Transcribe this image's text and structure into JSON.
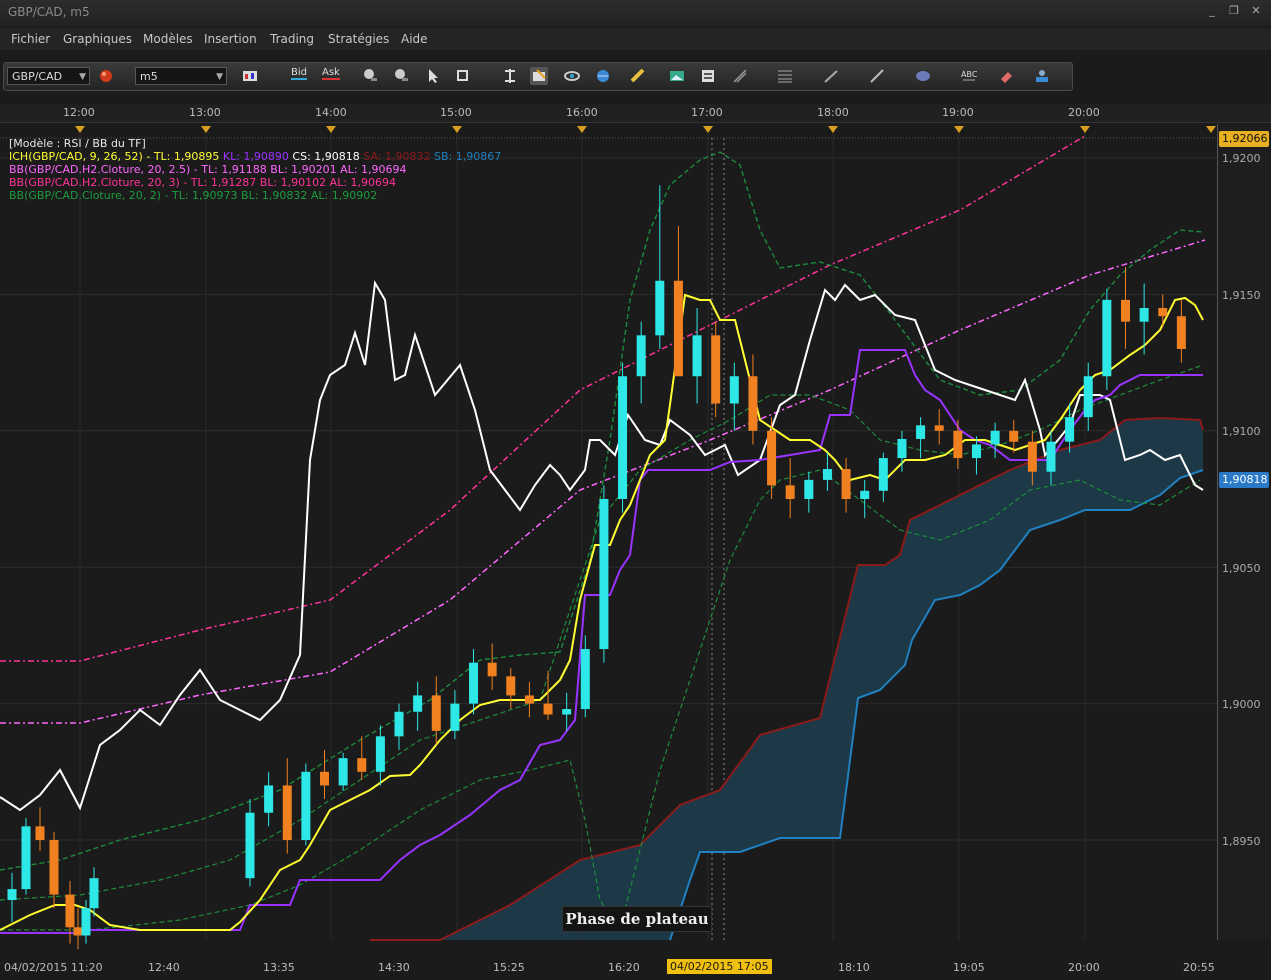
{
  "window": {
    "title": "GBP/CAD, m5",
    "minimize": "_",
    "restore": "❐",
    "close": "✕"
  },
  "menu": [
    "Fichier",
    "Graphiques",
    "Modèles",
    "Insertion",
    "Trading",
    "Stratégies",
    "Aide"
  ],
  "toolbar": {
    "symbol": "GBP/CAD",
    "timeframe": "m5",
    "bid_label": "Bid",
    "ask_label": "Ask",
    "icons": [
      "chart-type-icon",
      "red-ball-icon",
      "bar-style-icon",
      "zoom-in-icon",
      "zoom-out-icon",
      "cursor-icon",
      "crosshair-icon",
      "fit-icon",
      "cursor-sync-icon",
      "eye-icon",
      "globe-icon",
      "ruler-icon",
      "image-icon",
      "template-icon",
      "trendline-icon",
      "fib-icon",
      "pen-icon",
      "line-icon",
      "ellipse-icon",
      "text-icon",
      "eraser-icon",
      "objects-icon"
    ]
  },
  "time_axis_top": [
    "12:00",
    "13:00",
    "14:00",
    "15:00",
    "16:00",
    "17:00",
    "18:00",
    "19:00",
    "20:00"
  ],
  "time_axis_bottom": [
    "04/02/2015 11:20",
    "12:40",
    "13:35",
    "14:30",
    "15:25",
    "16:20",
    "18:10",
    "19:05",
    "20:00",
    "20:55"
  ],
  "cursor_time": "04/02/2015 17:05",
  "price_axis": [
    "1,9200",
    "1,9150",
    "1,9100",
    "1,9050",
    "1,9000",
    "1,8950"
  ],
  "price_tags": {
    "top": "1,92066",
    "current": "1,90818"
  },
  "legend": {
    "model": "[Modèle : RSI / BB du TF]",
    "ich_label": "ICH(GBP/CAD, 9, 26, 52) -",
    "ich_tl": "TL: 1,90895",
    "ich_kl": "KL: 1,90890",
    "ich_cs": "CS: 1,90818",
    "ich_sa": "SA: 1,90832",
    "ich_sb": "SB: 1,90867",
    "bb1": "BB(GBP/CAD.H2.Cloture, 20, 2.5) -  TL: 1,91188  BL: 1,90201  AL: 1,90694",
    "bb2": "BB(GBP/CAD.H2.Cloture, 20, 3) -  TL: 1,91287  BL: 1,90102  AL: 1,90694",
    "bb3": "BB(GBP/CAD.Cloture, 20, 2) -  TL: 1,90973  BL: 1,90832  AL: 1,90902"
  },
  "annotation": "Phase de plateau",
  "colors": {
    "bull": "#2ee8e8",
    "bear": "#f08020",
    "tenkan": "#ffff33",
    "kijun": "#9933ff",
    "chikou": "#ffffff",
    "cloud": "#1d3a4a",
    "senkou_a": "#8b1a1a",
    "senkou_b": "#2080c0",
    "bb_h2_25": "#ff66ff",
    "bb_h2_3": "#ff3399",
    "bb_m5": "#1c8c3c"
  },
  "chart_data": {
    "type": "candlestick",
    "symbol": "GBP/CAD",
    "timeframe": "m5",
    "ylim": [
      1.8905,
      1.9215
    ],
    "note_candles": "approximate OHLC read from chart, left to right",
    "candles": [
      [
        1.8928,
        1.8938,
        1.892,
        1.8932
      ],
      [
        1.8932,
        1.8958,
        1.893,
        1.8955
      ],
      [
        1.8955,
        1.8962,
        1.8946,
        1.895
      ],
      [
        1.895,
        1.8953,
        1.8925,
        1.893
      ],
      [
        1.893,
        1.8935,
        1.8912,
        1.8918
      ],
      [
        1.8918,
        1.8925,
        1.891,
        1.8915
      ],
      [
        1.8915,
        1.8928,
        1.8912,
        1.8925
      ],
      [
        1.8925,
        1.894,
        1.8922,
        1.8936
      ],
      [
        1.8936,
        1.8965,
        1.8933,
        1.896
      ],
      [
        1.896,
        1.8975,
        1.8955,
        1.897
      ],
      [
        1.897,
        1.898,
        1.8945,
        1.895
      ],
      [
        1.895,
        1.8978,
        1.8948,
        1.8975
      ],
      [
        1.8975,
        1.8983,
        1.8965,
        1.897
      ],
      [
        1.897,
        1.8982,
        1.8968,
        1.898
      ],
      [
        1.898,
        1.8988,
        1.8972,
        1.8975
      ],
      [
        1.8975,
        1.8992,
        1.897,
        1.8988
      ],
      [
        1.8988,
        1.9,
        1.8983,
        1.8997
      ],
      [
        1.8997,
        1.9008,
        1.899,
        1.9003
      ],
      [
        1.9003,
        1.901,
        1.8985,
        1.899
      ],
      [
        1.899,
        1.9005,
        1.8987,
        1.9
      ],
      [
        1.9,
        1.902,
        1.8996,
        1.9015
      ],
      [
        1.9015,
        1.9022,
        1.9005,
        1.901
      ],
      [
        1.901,
        1.9013,
        1.8998,
        1.9003
      ],
      [
        1.9003,
        1.9008,
        1.8995,
        1.9
      ],
      [
        1.9,
        1.9012,
        1.8994,
        1.8996
      ],
      [
        1.8996,
        1.9004,
        1.899,
        1.8998
      ],
      [
        1.8998,
        1.9025,
        1.8995,
        1.902
      ],
      [
        1.902,
        1.908,
        1.9015,
        1.9075
      ],
      [
        1.9075,
        1.9125,
        1.907,
        1.912
      ],
      [
        1.912,
        1.914,
        1.911,
        1.9135
      ],
      [
        1.9135,
        1.919,
        1.913,
        1.9155
      ],
      [
        1.9155,
        1.9175,
        1.913,
        1.912
      ],
      [
        1.912,
        1.9145,
        1.911,
        1.9135
      ],
      [
        1.9135,
        1.914,
        1.9105,
        1.911
      ],
      [
        1.911,
        1.9125,
        1.91,
        1.912
      ],
      [
        1.912,
        1.9128,
        1.9095,
        1.91
      ],
      [
        1.91,
        1.9105,
        1.9075,
        1.908
      ],
      [
        1.908,
        1.909,
        1.9068,
        1.9075
      ],
      [
        1.9075,
        1.9085,
        1.907,
        1.9082
      ],
      [
        1.9082,
        1.9092,
        1.9078,
        1.9086
      ],
      [
        1.9086,
        1.909,
        1.907,
        1.9075
      ],
      [
        1.9075,
        1.9082,
        1.9068,
        1.9078
      ],
      [
        1.9078,
        1.9092,
        1.9074,
        1.909
      ],
      [
        1.909,
        1.91,
        1.9085,
        1.9097
      ],
      [
        1.9097,
        1.9105,
        1.909,
        1.9102
      ],
      [
        1.9102,
        1.9108,
        1.9095,
        1.91
      ],
      [
        1.91,
        1.9104,
        1.9086,
        1.909
      ],
      [
        1.909,
        1.9098,
        1.9084,
        1.9095
      ],
      [
        1.9095,
        1.9103,
        1.909,
        1.91
      ],
      [
        1.91,
        1.9104,
        1.9092,
        1.9096
      ],
      [
        1.9096,
        1.91,
        1.908,
        1.9085
      ],
      [
        1.9085,
        1.91,
        1.908,
        1.9096
      ],
      [
        1.9096,
        1.911,
        1.9092,
        1.9105
      ],
      [
        1.9105,
        1.9125,
        1.91,
        1.912
      ],
      [
        1.912,
        1.9152,
        1.9115,
        1.9148
      ],
      [
        1.9148,
        1.916,
        1.913,
        1.914
      ],
      [
        1.914,
        1.9154,
        1.9128,
        1.9145
      ],
      [
        1.9145,
        1.915,
        1.9138,
        1.9142
      ],
      [
        1.9142,
        1.9148,
        1.9125,
        1.913
      ]
    ]
  }
}
